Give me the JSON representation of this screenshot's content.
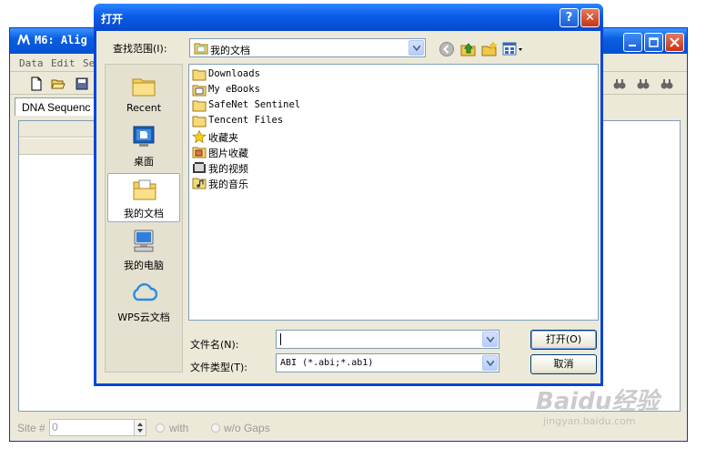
{
  "background_window": {
    "title": "M6: Alig",
    "menu": [
      "Data",
      "Edit",
      "Se"
    ],
    "tab_label": "DNA Sequenc",
    "status": {
      "site_label": "Site #",
      "site_value": "0",
      "with_label": "with",
      "wo_label": "w/o Gaps"
    }
  },
  "dialog": {
    "title": "打开",
    "help_label": "?",
    "close_label": "✕",
    "look_in_label": "查找范围(I):",
    "look_in_value": "我的文档",
    "places": [
      {
        "label": "Recent",
        "icon": "recent-folder-icon"
      },
      {
        "label": "桌面",
        "icon": "desktop-icon"
      },
      {
        "label": "我的文档",
        "icon": "my-documents-icon",
        "selected": true
      },
      {
        "label": "我的电脑",
        "icon": "my-computer-icon"
      },
      {
        "label": "WPS云文档",
        "icon": "cloud-icon"
      }
    ],
    "files": [
      {
        "name": "Downloads",
        "icon": "folder"
      },
      {
        "name": "My eBooks",
        "icon": "folder-special"
      },
      {
        "name": "SafeNet Sentinel",
        "icon": "folder"
      },
      {
        "name": "Tencent Files",
        "icon": "folder"
      },
      {
        "name": "收藏夹",
        "icon": "star"
      },
      {
        "name": "图片收藏",
        "icon": "pictures"
      },
      {
        "name": "我的视频",
        "icon": "video"
      },
      {
        "name": "我的音乐",
        "icon": "music"
      }
    ],
    "file_name_label": "文件名(N):",
    "file_name_value": "",
    "file_type_label": "文件类型(T):",
    "file_type_value": "ABI (*.abi;*.ab1)",
    "open_button": "打开(O)",
    "cancel_button": "取消"
  },
  "watermark": {
    "brand": "Baidu经验",
    "url": "jingyan.baidu.com"
  }
}
